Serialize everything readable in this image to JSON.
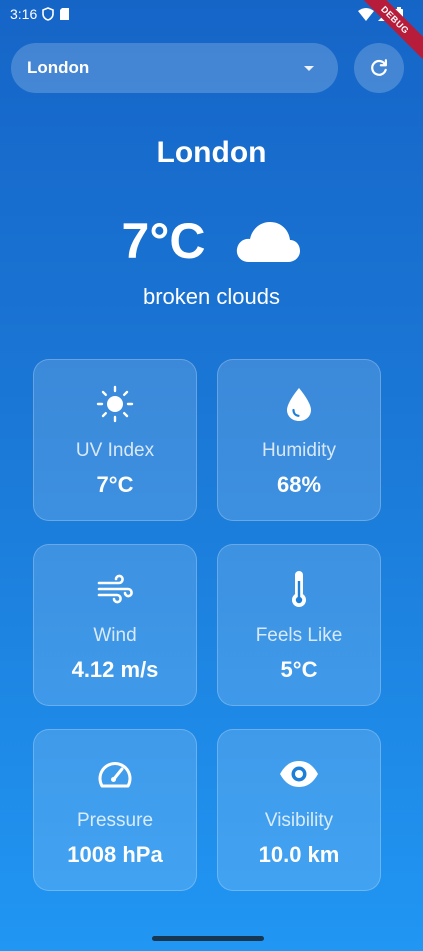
{
  "status_bar": {
    "time": "3:16",
    "debug_label": "DEBUG"
  },
  "city_selector": {
    "value": "London"
  },
  "weather": {
    "city": "London",
    "temperature": "7°C",
    "description": "broken clouds",
    "icon": "cloud-icon"
  },
  "cards": [
    {
      "label": "UV Index",
      "value": "7°C",
      "icon": "sun-icon"
    },
    {
      "label": "Humidity",
      "value": "68%",
      "icon": "water-drop-icon"
    },
    {
      "label": "Wind",
      "value": "4.12 m/s",
      "icon": "wind-icon"
    },
    {
      "label": "Feels Like",
      "value": "5°C",
      "icon": "thermometer-icon"
    },
    {
      "label": "Pressure",
      "value": "1008 hPa",
      "icon": "speedometer-icon"
    },
    {
      "label": "Visibility",
      "value": "10.0 km",
      "icon": "eye-icon"
    }
  ]
}
